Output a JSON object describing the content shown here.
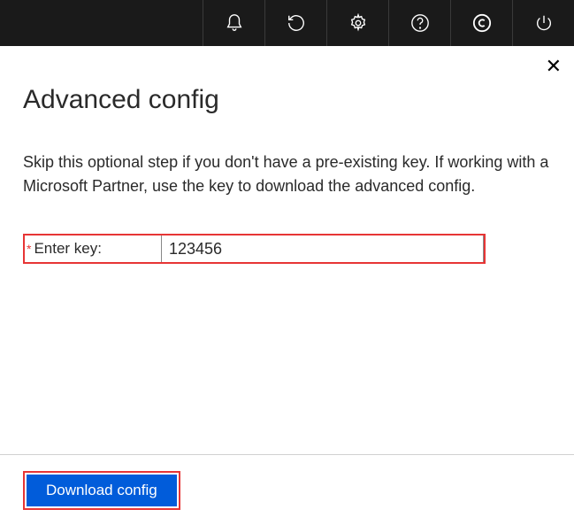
{
  "header": {
    "icons": [
      "notifications-icon",
      "refresh-icon",
      "settings-icon",
      "help-icon",
      "copyright-icon",
      "power-icon"
    ]
  },
  "panel": {
    "title": "Advanced config",
    "description": "Skip this optional step if you don't have a pre-existing key. If working with a Microsoft Partner, use the key to download the advanced config.",
    "key_field": {
      "label": "Enter key:",
      "required_mark": "*",
      "value": "123456"
    }
  },
  "footer": {
    "download_label": "Download config"
  }
}
